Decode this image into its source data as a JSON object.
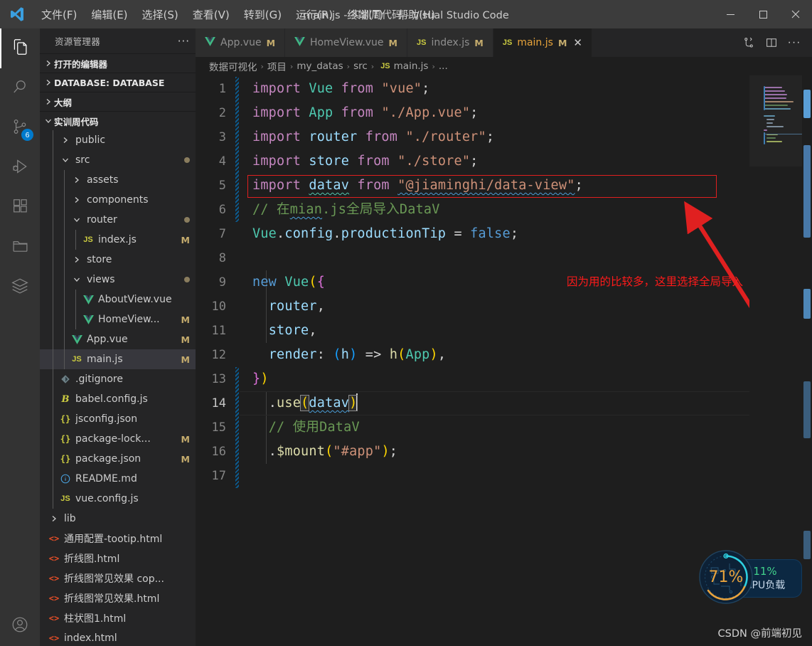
{
  "titlebar": {
    "logo_icon": "vscode-logo-icon",
    "menus": [
      "文件(F)",
      "编辑(E)",
      "选择(S)",
      "查看(V)",
      "转到(G)",
      "运行(R)",
      "终端(T)",
      "帮助(H)"
    ],
    "window_title": "main.js - 实训周代码 - Visual Studio Code",
    "minimize_label": "—",
    "maximize_label": "☐",
    "close_label": "✕"
  },
  "activitybar": {
    "items": [
      {
        "name": "explorer",
        "icon": "files-icon",
        "active": true,
        "badge": ""
      },
      {
        "name": "search",
        "icon": "search-icon",
        "active": false,
        "badge": ""
      },
      {
        "name": "source-control",
        "icon": "source-control-icon",
        "active": false,
        "badge": "6"
      },
      {
        "name": "run-and-debug",
        "icon": "run-debug-icon",
        "active": false,
        "badge": ""
      },
      {
        "name": "extensions",
        "icon": "extensions-icon",
        "active": false,
        "badge": ""
      },
      {
        "name": "remote-explorer",
        "icon": "folder-icon",
        "active": false,
        "badge": ""
      },
      {
        "name": "database-client",
        "icon": "layers-icon",
        "active": false,
        "badge": ""
      }
    ],
    "bottom": [
      {
        "name": "accounts",
        "icon": "account-icon",
        "badge": ""
      }
    ]
  },
  "sidebar": {
    "title": "资源管理器",
    "more_label": "···",
    "sections": [
      {
        "label": "打开的编辑器",
        "expanded": false
      },
      {
        "label": "DATABASE: DATABASE",
        "expanded": false
      },
      {
        "label": "大纲",
        "expanded": false
      },
      {
        "label": "实训周代码",
        "expanded": true
      }
    ],
    "tree": [
      {
        "label": "public",
        "indent": 1,
        "icon": "chevron-right-icon",
        "kind": "folder",
        "badge": "",
        "dot": false
      },
      {
        "label": "src",
        "indent": 1,
        "icon": "chevron-down-icon",
        "kind": "folder",
        "badge": "",
        "dot": true
      },
      {
        "label": "assets",
        "indent": 2,
        "icon": "chevron-right-icon",
        "kind": "folder",
        "badge": "",
        "dot": false
      },
      {
        "label": "components",
        "indent": 2,
        "icon": "chevron-right-icon",
        "kind": "folder",
        "badge": "",
        "dot": false
      },
      {
        "label": "router",
        "indent": 2,
        "icon": "chevron-down-icon",
        "kind": "folder",
        "badge": "",
        "dot": true
      },
      {
        "label": "index.js",
        "indent": 3,
        "icon": "js-file-icon",
        "kind": "js",
        "badge": "M",
        "dot": false
      },
      {
        "label": "store",
        "indent": 2,
        "icon": "chevron-right-icon",
        "kind": "folder",
        "badge": "",
        "dot": false
      },
      {
        "label": "views",
        "indent": 2,
        "icon": "chevron-down-icon",
        "kind": "folder",
        "badge": "",
        "dot": true
      },
      {
        "label": "AboutView.vue",
        "indent": 3,
        "icon": "vue-file-icon",
        "kind": "vue",
        "badge": "",
        "dot": false
      },
      {
        "label": "HomeView...",
        "indent": 3,
        "icon": "vue-file-icon",
        "kind": "vue",
        "badge": "M",
        "dot": false
      },
      {
        "label": "App.vue",
        "indent": 2,
        "icon": "vue-file-icon",
        "kind": "vue",
        "badge": "M",
        "dot": false
      },
      {
        "label": "main.js",
        "indent": 2,
        "icon": "js-file-icon",
        "kind": "js",
        "badge": "M",
        "dot": false,
        "selected": true
      },
      {
        "label": ".gitignore",
        "indent": 1,
        "icon": "git-file-icon",
        "kind": "git",
        "badge": "",
        "dot": false
      },
      {
        "label": "babel.config.js",
        "indent": 1,
        "icon": "babel-file-icon",
        "kind": "babel",
        "badge": "",
        "dot": false
      },
      {
        "label": "jsconfig.json",
        "indent": 1,
        "icon": "json-file-icon",
        "kind": "json",
        "badge": "",
        "dot": false
      },
      {
        "label": "package-lock...",
        "indent": 1,
        "icon": "json-file-icon",
        "kind": "json",
        "badge": "M",
        "dot": false
      },
      {
        "label": "package.json",
        "indent": 1,
        "icon": "json-file-icon",
        "kind": "json",
        "badge": "M",
        "dot": false
      },
      {
        "label": "README.md",
        "indent": 1,
        "icon": "info-file-icon",
        "kind": "md",
        "badge": "",
        "dot": false
      },
      {
        "label": "vue.config.js",
        "indent": 1,
        "icon": "js-file-icon",
        "kind": "js",
        "badge": "",
        "dot": false
      },
      {
        "label": "lib",
        "indent": 0,
        "icon": "chevron-right-icon",
        "kind": "folder",
        "badge": "",
        "dot": false
      },
      {
        "label": "通用配置-tootip.html",
        "indent": 0,
        "icon": "html-file-icon",
        "kind": "html",
        "badge": "",
        "dot": false
      },
      {
        "label": "折线图.html",
        "indent": 0,
        "icon": "html-file-icon",
        "kind": "html",
        "badge": "",
        "dot": false
      },
      {
        "label": "折线图常见效果 cop...",
        "indent": 0,
        "icon": "html-file-icon",
        "kind": "html",
        "badge": "",
        "dot": false
      },
      {
        "label": "折线图常见效果.html",
        "indent": 0,
        "icon": "html-file-icon",
        "kind": "html",
        "badge": "",
        "dot": false
      },
      {
        "label": "柱状图1.html",
        "indent": 0,
        "icon": "html-file-icon",
        "kind": "html",
        "badge": "",
        "dot": false
      },
      {
        "label": "index.html",
        "indent": 0,
        "icon": "html-file-icon",
        "kind": "html",
        "badge": "",
        "dot": false
      }
    ]
  },
  "tabs": [
    {
      "label": "App.vue",
      "icon": "vue-file-icon",
      "modified": "M",
      "active": false,
      "closable": false
    },
    {
      "label": "HomeView.vue",
      "icon": "vue-file-icon",
      "modified": "M",
      "active": false,
      "closable": false
    },
    {
      "label": "index.js",
      "icon": "js-file-icon",
      "modified": "M",
      "active": false,
      "closable": false
    },
    {
      "label": "main.js",
      "icon": "js-file-icon",
      "modified": "M",
      "active": true,
      "closable": true,
      "close_label": "✕"
    }
  ],
  "tab_actions": [
    {
      "name": "split-source-control-icon",
      "label": ""
    },
    {
      "name": "split-editor-icon",
      "label": ""
    },
    {
      "name": "more-actions-icon",
      "label": "···"
    }
  ],
  "breadcrumb": {
    "separator": "›",
    "items": [
      "数据可视化",
      "项目",
      "my_datas",
      "src",
      "main.js",
      "..."
    ],
    "file_icon_index": 4
  },
  "editor": {
    "line_count": 17,
    "current_line": 14,
    "line_numbers": [
      "1",
      "2",
      "3",
      "4",
      "5",
      "6",
      "7",
      "8",
      "9",
      "10",
      "11",
      "12",
      "13",
      "14",
      "15",
      "16",
      "17"
    ],
    "lines": [
      "import Vue from \"vue\";",
      "import App from \"./App.vue\";",
      "import router from \"./router\";",
      "import store from \"./store\";",
      "import datav from \"@jiaminghi/data-view\";",
      "// 在mian.js全局导入DataV",
      "Vue.config.productionTip = false;",
      "",
      "new Vue({",
      "  router,",
      "  store,",
      "  render: (h) => h(App),",
      "})",
      "  .use(datav)",
      "  // 使用DataV",
      "  .$mount(\"#app\");",
      ""
    ]
  },
  "annotation": {
    "text": "因为用的比较多，这里选择全局导入",
    "color": "#ff1a1a",
    "highlight_box_line": 5,
    "arrow": "red-arrow-icon"
  },
  "cpu_widget": {
    "gauge_value": "71%",
    "load_percent": "11%",
    "load_label": "CPU负载",
    "gauge_color": "#e8a33d",
    "accent_color": "#41d18b"
  },
  "watermark": {
    "text": "CSDN @前端初见"
  }
}
